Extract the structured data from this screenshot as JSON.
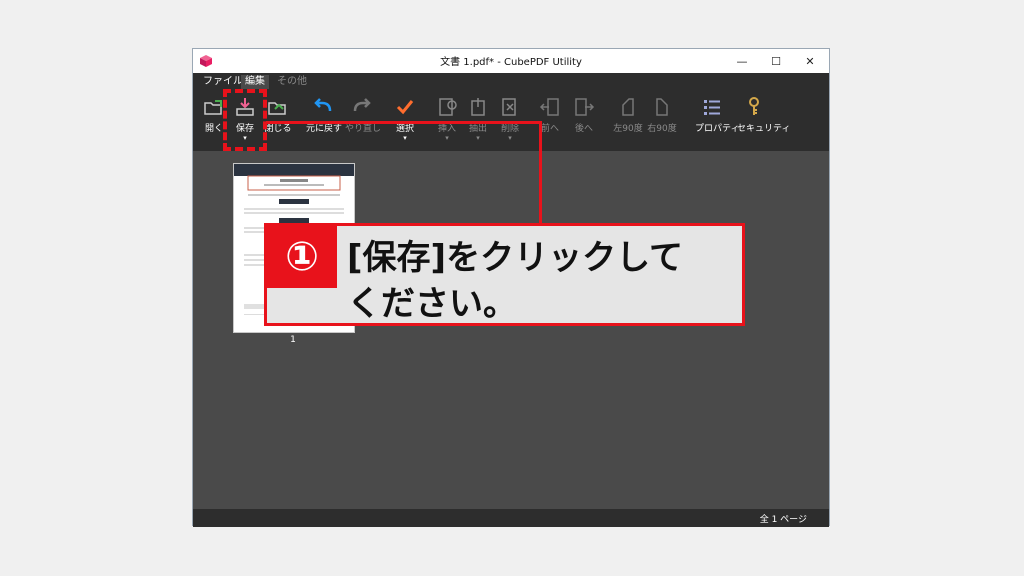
{
  "window": {
    "title": "文書 1.pdf* - CubePDF Utility",
    "minimize": "—",
    "maximize": "☐",
    "close": "✕"
  },
  "menubar": {
    "items": [
      "ファイル",
      "編集",
      "その他"
    ]
  },
  "toolbar": {
    "open": "開く",
    "save": "保存",
    "close": "閉じる",
    "undo": "元に戻す",
    "redo": "やり直し",
    "select": "選択",
    "insert": "挿入",
    "extract": "抽出",
    "delete": "削除",
    "prev": "前へ",
    "next": "後へ",
    "rotate_left": "左90度",
    "rotate_right": "右90度",
    "properties": "プロパティ",
    "security": "セキュリティ",
    "dropdown_arrow": "▾"
  },
  "thumbnail": {
    "page_number": "1"
  },
  "status": {
    "page_count": "全 1 ページ"
  },
  "callout": {
    "number": "①",
    "line1": "[保存]をクリックして",
    "line2": "ください。"
  },
  "colors": {
    "accent": "#e8121b",
    "toolbar_bg": "#2d2d2d",
    "content_bg": "#4a4a4a"
  }
}
